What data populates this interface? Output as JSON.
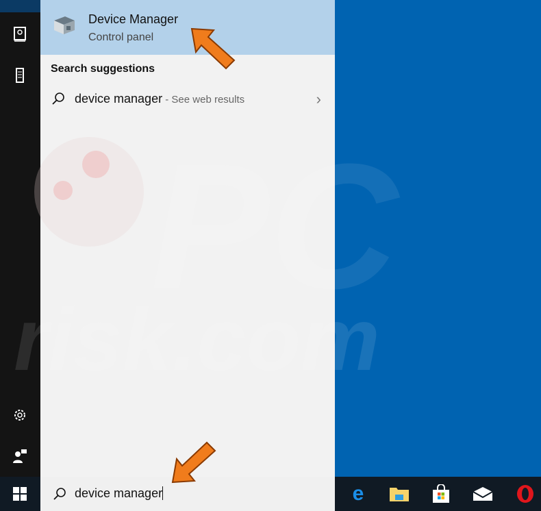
{
  "best_match": {
    "title": "Device Manager",
    "subtitle": "Control panel"
  },
  "suggestions": {
    "heading": "Search suggestions",
    "items": [
      {
        "query": "device manager",
        "suffix": " - See web results"
      }
    ]
  },
  "search": {
    "value": "device manager"
  },
  "watermark": "PC risk.com",
  "colors": {
    "desktop": "#0063b1",
    "highlight": "#b3d1ea",
    "arrow": "#f07c1c"
  }
}
